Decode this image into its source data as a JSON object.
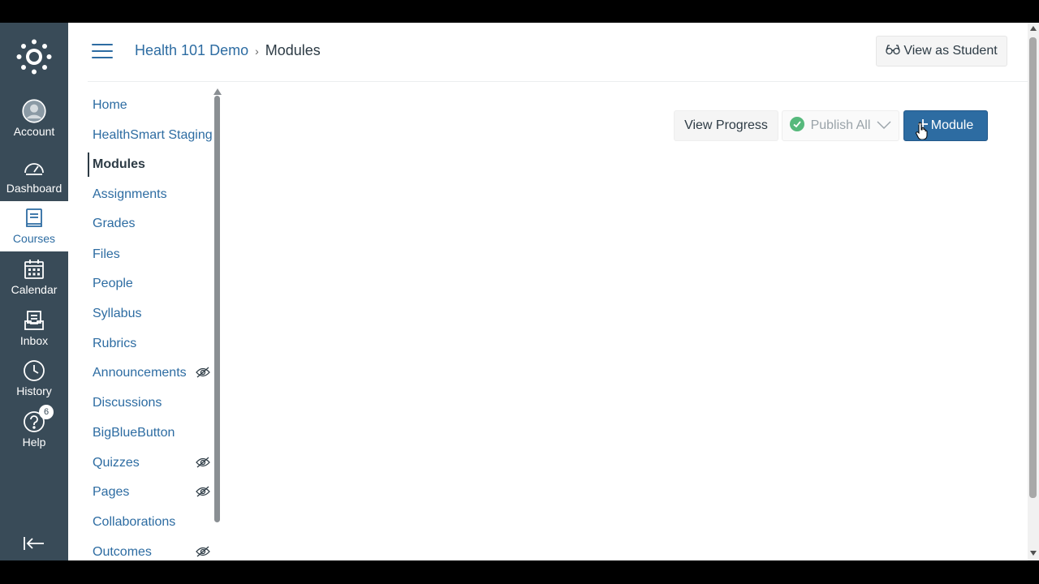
{
  "global_nav": {
    "items": [
      {
        "label": "Account",
        "icon": "account-avatar-icon"
      },
      {
        "label": "Dashboard",
        "icon": "dashboard-icon"
      },
      {
        "label": "Courses",
        "icon": "courses-icon"
      },
      {
        "label": "Calendar",
        "icon": "calendar-icon"
      },
      {
        "label": "Inbox",
        "icon": "inbox-icon"
      },
      {
        "label": "History",
        "icon": "history-icon"
      },
      {
        "label": "Help",
        "icon": "help-icon",
        "badge": "6"
      }
    ],
    "active": "Courses"
  },
  "header": {
    "course_link": "Health 101 Demo",
    "separator": "›",
    "current_page": "Modules",
    "view_as_student": "View as Student"
  },
  "course_nav": {
    "items": [
      {
        "label": "Home"
      },
      {
        "label": "HealthSmart Staging"
      },
      {
        "label": "Modules",
        "active": true
      },
      {
        "label": "Assignments"
      },
      {
        "label": "Grades"
      },
      {
        "label": "Files"
      },
      {
        "label": "People"
      },
      {
        "label": "Syllabus"
      },
      {
        "label": "Rubrics"
      },
      {
        "label": "Announcements",
        "hidden_icon": true
      },
      {
        "label": "Discussions"
      },
      {
        "label": "BigBlueButton"
      },
      {
        "label": "Quizzes",
        "hidden_icon": true
      },
      {
        "label": "Pages",
        "hidden_icon": true
      },
      {
        "label": "Collaborations"
      },
      {
        "label": "Outcomes",
        "hidden_icon": true
      }
    ]
  },
  "toolbar": {
    "view_progress": "View Progress",
    "publish_all": "Publish All",
    "add_module": "Module"
  },
  "colors": {
    "nav_bg": "#394b58",
    "link": "#2d6ca2",
    "primary": "#2d6ca2",
    "published": "#56b97c"
  }
}
